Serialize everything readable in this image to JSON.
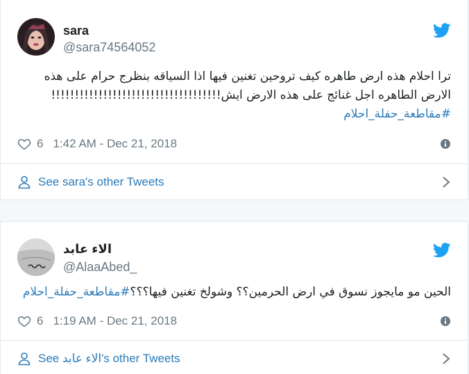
{
  "tweets": [
    {
      "name": "sara",
      "handle": "@sara74564052",
      "text": "ترا احلام هذه ارض طاهره كيف تروحين تغنين فيها اذا السياقه بنظرج حرام على هذه الارض الطاهره اجل غنائج على هذه الارض ايش!!!!!!!!!!!!!!!!!!!!!!!!!!!!!!!!!!!!",
      "hashtag": "#مقاطعة_حفلة_احلام",
      "likes": "6",
      "timestamp": "1:42 AM - Dec 21, 2018",
      "other_tweets": "See sara's other Tweets",
      "avatar_icon": "woman-avatar",
      "avatar_colors": [
        "#2a1d20",
        "#b9486a",
        "#e8c0b0"
      ]
    },
    {
      "name": "الاء عابد",
      "handle": "@AlaaAbed_",
      "text": "الحين مو مايجوز نسوق في ارض الحرمين؟؟ وشولخ تغنين فيها؟؟؟",
      "hashtag": "#مقاطعة_حفلة_احلام",
      "likes": "6",
      "timestamp": "1:19 AM - Dec 21, 2018",
      "other_tweets": "See الاء عابد's other Tweets",
      "avatar_icon": "wrist-tattoo-avatar",
      "avatar_colors": [
        "#d9d9d9",
        "#8a8a8a",
        "#2a2a2a"
      ]
    }
  ],
  "colors": {
    "link": "#2b7bb9",
    "twitter_blue": "#1da1f2",
    "muted": "#697882",
    "border": "#e1e8ed",
    "background": "#f5f8fa"
  }
}
